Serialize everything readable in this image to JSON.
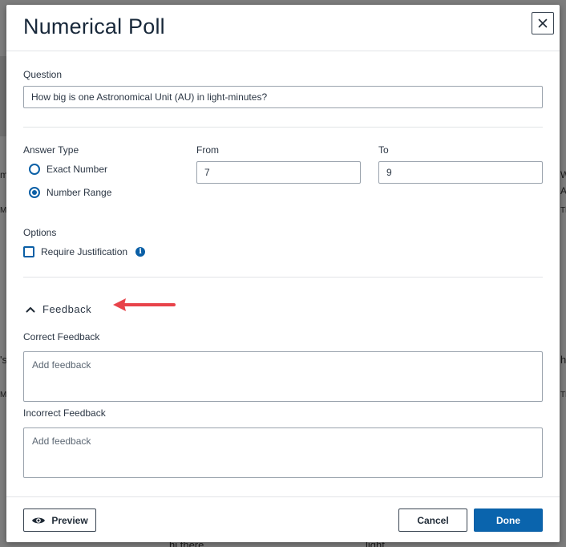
{
  "background": {
    "left_fragments": [
      "m",
      "Mu",
      "'s",
      "Mu"
    ],
    "right_fragments": [
      "W",
      "A",
      "Th",
      "h",
      "Th"
    ],
    "bottom_fragments": [
      "hi there",
      "light"
    ]
  },
  "modal": {
    "title": "Numerical Poll",
    "close_label": "×"
  },
  "question": {
    "label": "Question",
    "value": "How big is one Astronomical Unit (AU) in light-minutes?"
  },
  "answer_type": {
    "label": "Answer Type",
    "options": [
      {
        "label": "Exact Number",
        "selected": false
      },
      {
        "label": "Number Range",
        "selected": true
      }
    ]
  },
  "range": {
    "from_label": "From",
    "from_value": "7",
    "to_label": "To",
    "to_value": "9"
  },
  "options": {
    "label": "Options",
    "require_justification_label": "Require Justification",
    "require_justification_checked": false
  },
  "feedback": {
    "title": "Feedback",
    "correct_label": "Correct Feedback",
    "correct_placeholder": "Add feedback",
    "incorrect_label": "Incorrect Feedback",
    "incorrect_placeholder": "Add feedback"
  },
  "footer": {
    "preview_label": "Preview",
    "cancel_label": "Cancel",
    "done_label": "Done"
  },
  "colors": {
    "accent": "#0a64ad",
    "annotation_arrow": "#e8434a"
  }
}
